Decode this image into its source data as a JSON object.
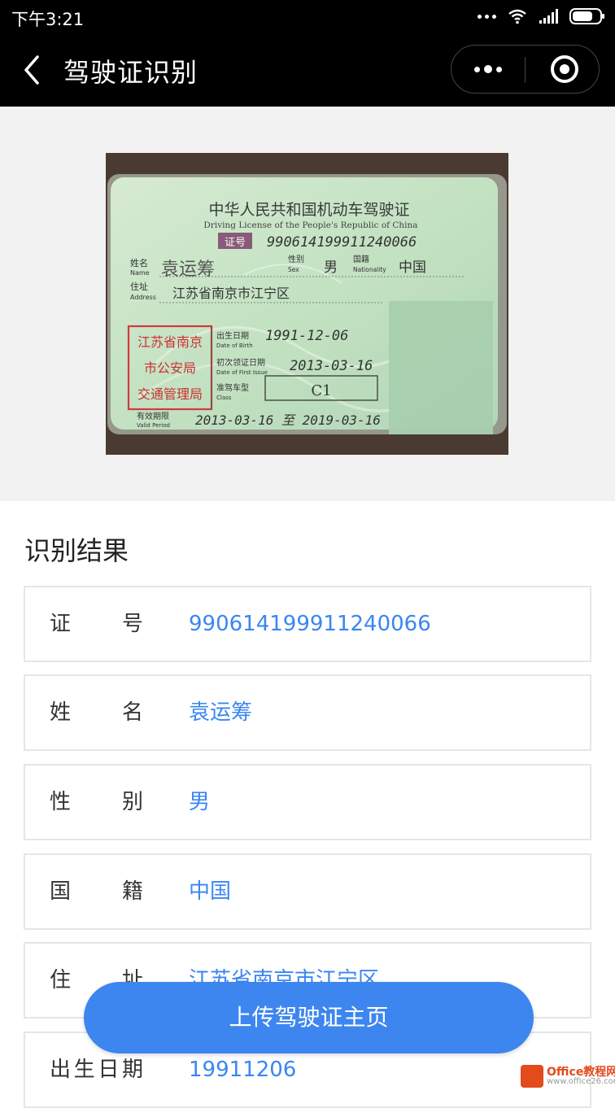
{
  "status": {
    "time": "下午3:21"
  },
  "nav": {
    "title": "驾驶证识别"
  },
  "card": {
    "title_cn": "中华人民共和国机动车驾驶证",
    "title_en": "Driving License of the People's Republic of China",
    "tag": "证号",
    "number": "990614199911240066",
    "name_label_cn": "姓名",
    "name_label_en": "Name",
    "name": "袁运筹",
    "sex_label_cn": "性别",
    "sex_label_en": "Sex",
    "sex": "男",
    "nat_label_cn": "国籍",
    "nat_label_en": "Nationality",
    "nationality": "中国",
    "addr_label_cn": "住址",
    "addr_label_en": "Address",
    "address": "江苏省南京市江宁区",
    "seal_lines": [
      "江苏省南京",
      "市公安局",
      "交通管理局"
    ],
    "dob_label_cn": "出生日期",
    "dob_label_en": "Date of Birth",
    "dob": "1991-12-06",
    "issue_label_cn": "初次领证日期",
    "issue_label_en": "Date of First Issue",
    "issue": "2013-03-16",
    "class_label_cn": "准驾车型",
    "class_label_en": "Class",
    "class": "C1",
    "valid_label_cn": "有效期限",
    "valid_label_en": "Valid Period",
    "valid": "2013-03-16 至 2019-03-16"
  },
  "results": {
    "title": "识别结果",
    "rows": [
      {
        "label": "证号",
        "value": "990614199911240066"
      },
      {
        "label": "姓名",
        "value": "袁运筹"
      },
      {
        "label": "性别",
        "value": "男"
      },
      {
        "label": "国籍",
        "value": "中国"
      },
      {
        "label": "住址",
        "value": "江苏省南京市江宁区"
      },
      {
        "label": "出生日期",
        "value": "19911206"
      }
    ]
  },
  "upload_button": "上传驾驶证主页",
  "watermark": {
    "line1": "Office教程网",
    "line2": "www.office26.com"
  }
}
